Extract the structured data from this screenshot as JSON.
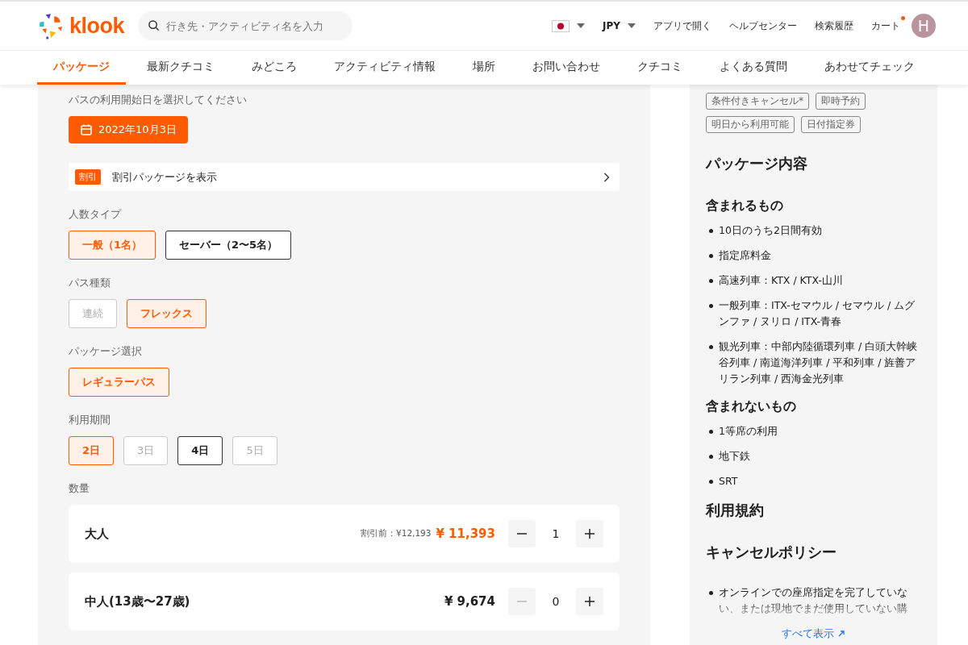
{
  "header": {
    "logo": "klook",
    "search": {
      "placeholder": "行き先・アクティビティ名を入力"
    },
    "currency": "JPY",
    "links": [
      "アプリで開く",
      "ヘルプセンター",
      "検索履歴"
    ],
    "cart": {
      "label": "カート",
      "notification": true
    },
    "avatar": "H"
  },
  "nav": [
    {
      "label": "パッケージ",
      "selected": true
    },
    {
      "label": "最新クチコミ",
      "selected": false
    },
    {
      "label": "みどころ",
      "selected": false
    },
    {
      "label": "アクティビティ情報",
      "selected": false
    },
    {
      "label": "場所",
      "selected": false
    },
    {
      "label": "お問い合わせ",
      "selected": false
    },
    {
      "label": "クチコミ",
      "selected": false
    },
    {
      "label": "よくある質問",
      "selected": false
    },
    {
      "label": "あわせてチェック",
      "selected": false
    }
  ],
  "date_section": {
    "label": "パスの利用開始日を選択してください",
    "date": "2022年10月3日"
  },
  "discount_banner": {
    "badge": "割引",
    "text": "割引パッケージを表示"
  },
  "option_groups": [
    {
      "label": "人数タイプ",
      "options": [
        {
          "label": "一般（1名）",
          "selected": true,
          "disabled": false
        },
        {
          "label": "セーバー（2〜5名）",
          "selected": false,
          "disabled": false
        }
      ]
    },
    {
      "label": "パス種類",
      "options": [
        {
          "label": "連続",
          "selected": false,
          "disabled": true
        },
        {
          "label": "フレックス",
          "selected": true,
          "disabled": false
        }
      ]
    },
    {
      "label": "パッケージ選択",
      "options": [
        {
          "label": "レギュラーパス",
          "selected": true,
          "disabled": false
        }
      ]
    },
    {
      "label": "利用期間",
      "options": [
        {
          "label": "2日",
          "selected": true,
          "disabled": false
        },
        {
          "label": "3日",
          "selected": false,
          "disabled": true
        },
        {
          "label": "4日",
          "selected": false,
          "disabled": false
        },
        {
          "label": "5日",
          "selected": false,
          "disabled": true
        }
      ]
    }
  ],
  "quantity": {
    "label": "数量",
    "rows": [
      {
        "name": "大人",
        "original_price": "割引前：¥12,193",
        "price": "¥ 11,393",
        "discounted": true,
        "count": "1",
        "minus_disabled": false
      },
      {
        "name": "中人(13歳〜27歳)",
        "price": "¥ 9,674",
        "discounted": false,
        "count": "0",
        "minus_disabled": true
      }
    ]
  },
  "sidebar": {
    "tags": [
      "条件付きキャンセル*",
      "即時予約",
      "明日から利用可能",
      "日付指定券"
    ],
    "title": "パッケージ内容",
    "included": {
      "heading": "含まれるもの",
      "items": [
        "10日のうち2日間有効",
        "指定席料金",
        "高速列車：KTX / KTX-山川",
        "一般列車：ITX-セマウル / セマウル / ムグンファ / ヌリロ / ITX-青春",
        "観光列車：中部内陸循環列車 / 白頭大幹峡谷列車 / 南道海洋列車 / 平和列車 / 旌善アリラン列車 / 西海金光列車"
      ]
    },
    "excluded": {
      "heading": "含まれないもの",
      "items": [
        "1等席の利用",
        "地下鉄",
        "SRT"
      ]
    },
    "terms_heading": "利用規約",
    "cancel": {
      "heading": "キャンセルポリシー",
      "items": [
        "オンラインでの座席指定を完了していない、または現地でまだ使用していない購"
      ]
    },
    "show_all": "すべて表示"
  }
}
